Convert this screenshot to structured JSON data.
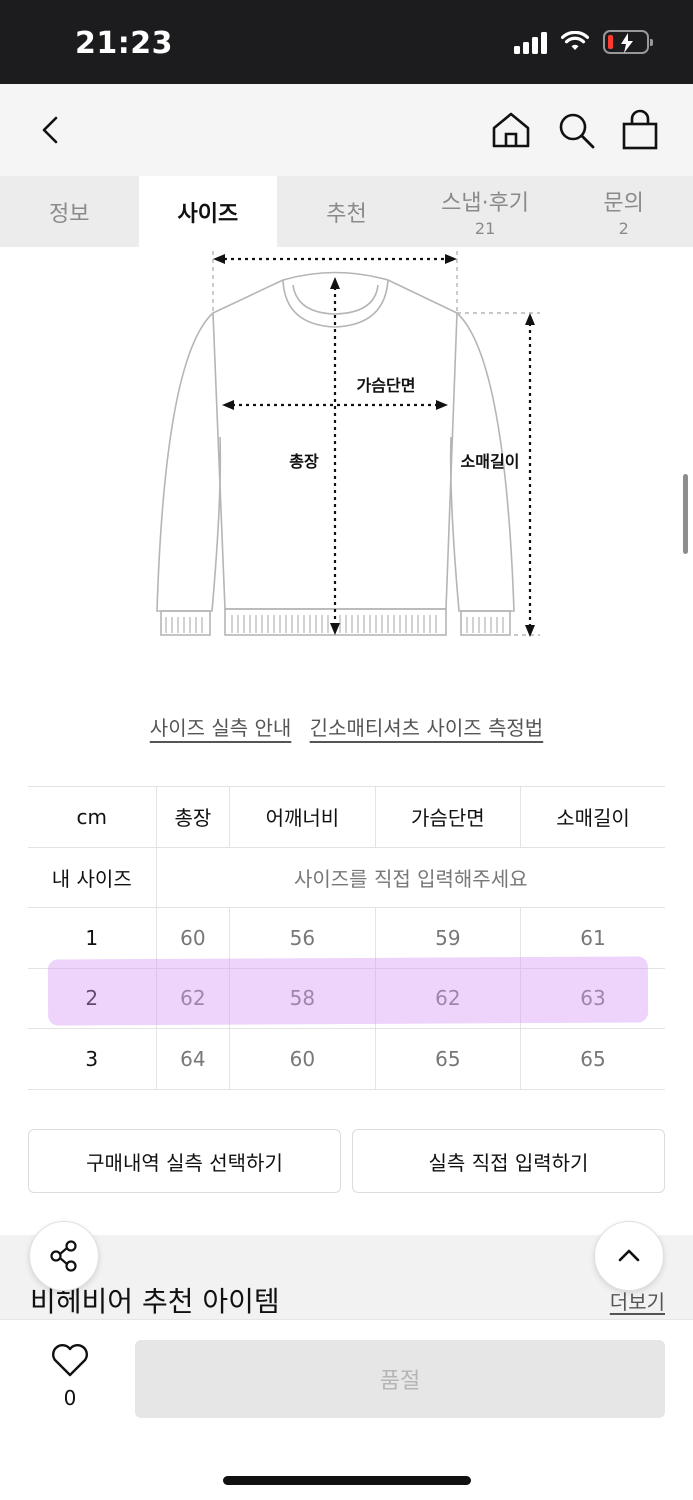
{
  "status_bar": {
    "time": "21:23"
  },
  "tabs": [
    {
      "label": "정보",
      "count": ""
    },
    {
      "label": "사이즈",
      "count": ""
    },
    {
      "label": "추천",
      "count": ""
    },
    {
      "label": "스냅·후기",
      "count": "21"
    },
    {
      "label": "문의",
      "count": "2"
    }
  ],
  "active_tab": "사이즈",
  "diagram": {
    "chest_label": "가슴단면",
    "length_label": "총장",
    "sleeve_label": "소매길이"
  },
  "guide_links": {
    "guide": "사이즈 실측 안내",
    "method": "긴소매티셔츠 사이즈 측정법"
  },
  "size_table": {
    "unit": "cm",
    "headers": [
      "총장",
      "어깨너비",
      "가슴단면",
      "소매길이"
    ],
    "my_size_label": "내 사이즈",
    "my_size_placeholder": "사이즈를 직접 입력해주세요",
    "rows": [
      {
        "size": "1",
        "values": [
          "60",
          "56",
          "59",
          "61"
        ]
      },
      {
        "size": "2",
        "values": [
          "62",
          "58",
          "62",
          "63"
        ]
      },
      {
        "size": "3",
        "values": [
          "64",
          "60",
          "65",
          "65"
        ]
      }
    ],
    "highlighted_row": "2",
    "highlight_color": "#d796f5"
  },
  "buttons": {
    "purchase_history": "구매내역 실측 선택하기",
    "direct_input": "실측 직접 입력하기"
  },
  "recommend": {
    "title": "비헤비어 추천 아이템",
    "more": "더보기"
  },
  "bottom": {
    "like_count": "0",
    "soldout": "품절"
  },
  "icons": [
    "back-icon",
    "home-icon",
    "search-icon",
    "cart-icon",
    "share-icon",
    "chevron-up-icon",
    "heart-icon",
    "signal-icon",
    "wifi-icon",
    "battery-icon"
  ]
}
